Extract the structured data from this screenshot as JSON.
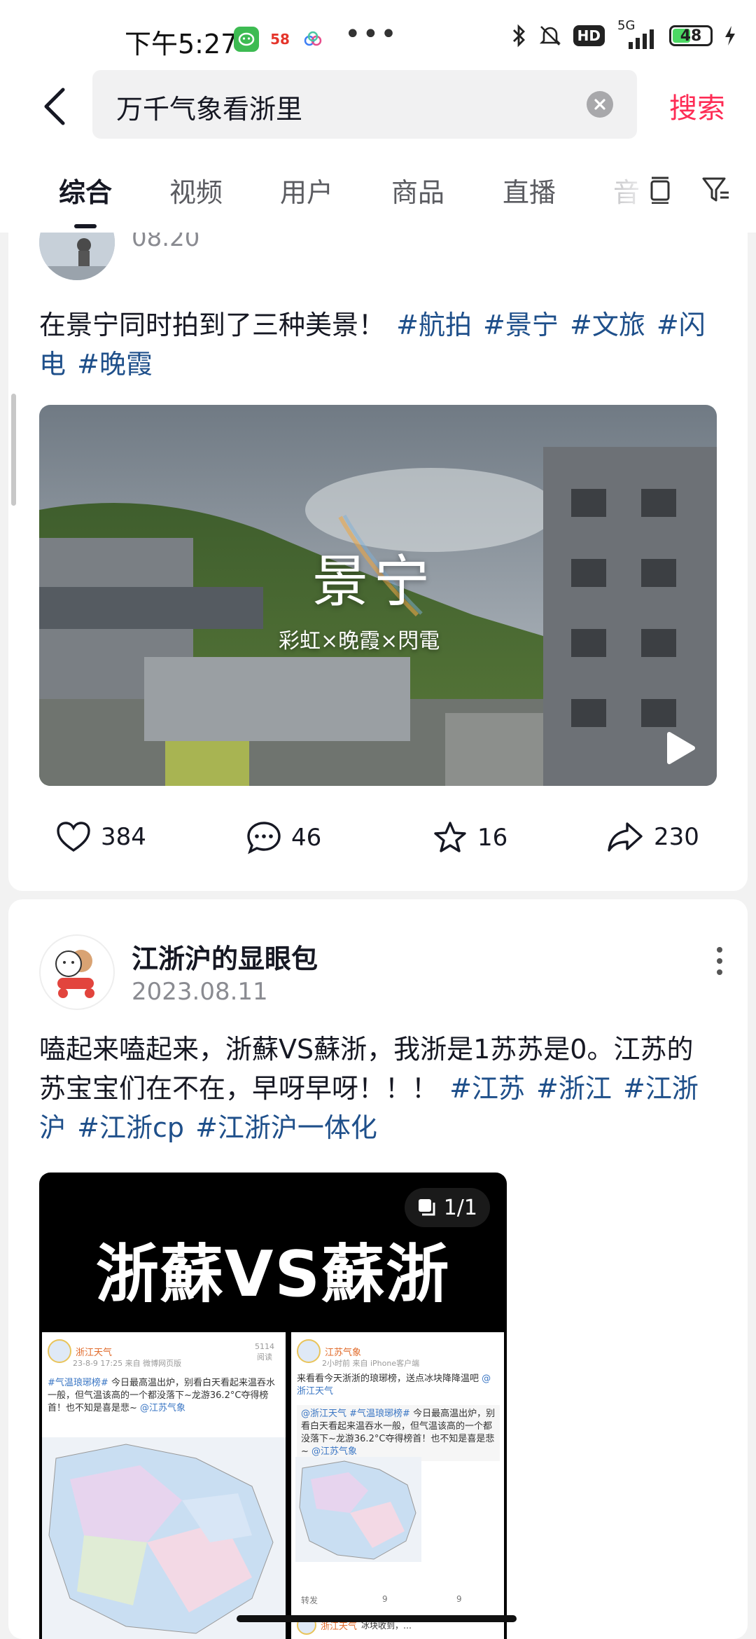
{
  "status_bar": {
    "time": "下午5:27",
    "app_badge_58": "58",
    "network": "5G",
    "hd": "HD",
    "battery": "48"
  },
  "search": {
    "query": "万千气象看浙里",
    "submit_label": "搜索",
    "icons": [
      "back-arrow-icon",
      "clear-icon"
    ]
  },
  "tabs": [
    {
      "label": "综合",
      "active": true
    },
    {
      "label": "视频"
    },
    {
      "label": "用户"
    },
    {
      "label": "商品"
    },
    {
      "label": "直播"
    },
    {
      "label": "音"
    }
  ],
  "posts": [
    {
      "date": "08.20",
      "text": "在景宁同时拍到了三种美景！",
      "tags": [
        "#航拍",
        "#景宁",
        "#文旅",
        "#闪电",
        "#晚霞"
      ],
      "video": {
        "title": "景宁",
        "subtitle": "彩虹×晚霞×閃電"
      },
      "actions": {
        "likes": "384",
        "comments": "46",
        "favorites": "16",
        "shares": "230"
      }
    },
    {
      "author": "江浙沪的显眼包",
      "date": "2023.08.11",
      "text": "嗑起来嗑起来，浙蘇VS蘇浙，我浙是1苏苏是0。江苏的苏宝宝们在不在，早呀早呀！！！",
      "tags": [
        "#江苏",
        "#浙江",
        "#江浙沪",
        "#江浙cp",
        "#江浙沪一体化"
      ],
      "image": {
        "counter": "1/1",
        "title": "浙蘇VS蘇浙",
        "left_shot": {
          "name": "浙江天气",
          "meta": "23-8-9 17:25  来自 微博网页版",
          "views": "5114",
          "views_label": "阅读",
          "text_tag": "#气温琅琊榜#",
          "text": "今日最高温出炉，别看白天看起来温吞水一般，但气温该高的一个都没落下~龙游36.2°C夺得榜首！也不知是喜是悲~",
          "mention": "@江苏气象"
        },
        "right_shot": {
          "name": "江苏气象",
          "meta": "2小时前  来自 iPhone客户端",
          "text": "来看看今天浙浙的琅琊榜，送点冰块降降温吧",
          "mention": "@浙江天气",
          "quote_source": "@浙江天气",
          "quote_tag": "#气温琅琊榜#",
          "quote_text": "今日最高温出炉，别看白天看起来温吞水一般，但气温该高的一个都没落下~龙游36.2°C夺得榜首！也不知是喜是悲~",
          "quote_mention": "@江苏气象",
          "forward_label": "转发",
          "comments": "9",
          "likes": "9",
          "next_name": "浙江天气",
          "next_text": "冰块收到，…"
        }
      }
    }
  ],
  "colors": {
    "accent": "#fe2c55",
    "hashtag": "#1e4f8a"
  }
}
